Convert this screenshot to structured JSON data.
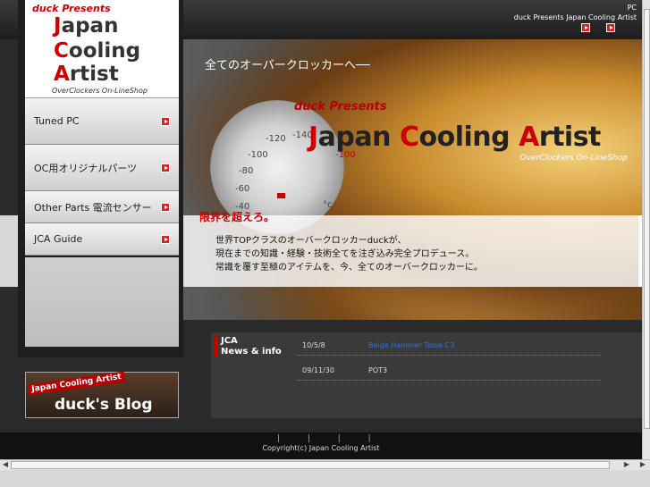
{
  "header": {
    "top_right_line1": "PC",
    "top_right_line2": "duck Presents  Japan Cooling Artist"
  },
  "logo": {
    "presents": "duck Presents",
    "line1_cap": "J",
    "line1_rest": "apan",
    "line2_cap": "C",
    "line2_rest": "ooling",
    "line3_cap": "A",
    "line3_rest": "rtist",
    "tagline": "OverClockers On-LineShop"
  },
  "menu": {
    "items": [
      {
        "label": "Tuned PC"
      },
      {
        "label": "OC用オリジナルパーツ"
      },
      {
        "label": "Other Parts 電流センサー"
      },
      {
        "label": "JCA Guide"
      }
    ]
  },
  "hero": {
    "tagline": "全てのオーバークロッカーへ──",
    "presents": "duck Presents",
    "title_word1_cap": "J",
    "title_word1_rest": "apan",
    "title_word2_cap": "C",
    "title_word2_rest": "ooling",
    "title_word3_cap": "A",
    "title_word3_rest": "rtist",
    "online": "OverClockers On-LineShop",
    "catch": "限界を超えろ。",
    "body_line1": "世界TOPクラスのオーバークロッカーduckが、",
    "body_line2": "現在までの知識・経験・技術全てを注ぎ込み完全プロデュース。",
    "body_line3": "常識を覆す至極のアイテムを、今、全てのオーバークロッカーに。",
    "gauge_ticks": [
      "-140",
      "-120",
      "-100",
      "-80",
      "-60",
      "-40",
      "-100",
      "°c"
    ]
  },
  "blog": {
    "top_label": "Japan Cooling Artist",
    "main_label": "duck's Blog"
  },
  "news": {
    "heading_line1": "JCA",
    "heading_line2": "News & info",
    "rows": [
      {
        "date": "10/5/8",
        "text": "Beige Hammer Table C3"
      },
      {
        "date": "09/11/30",
        "text": "POT3"
      }
    ]
  },
  "footer": {
    "links": "| | | |",
    "copyright": "Copyright(c) Japan Cooling Artist"
  },
  "colors": {
    "accent": "#cc0000",
    "link": "#3470d6"
  }
}
